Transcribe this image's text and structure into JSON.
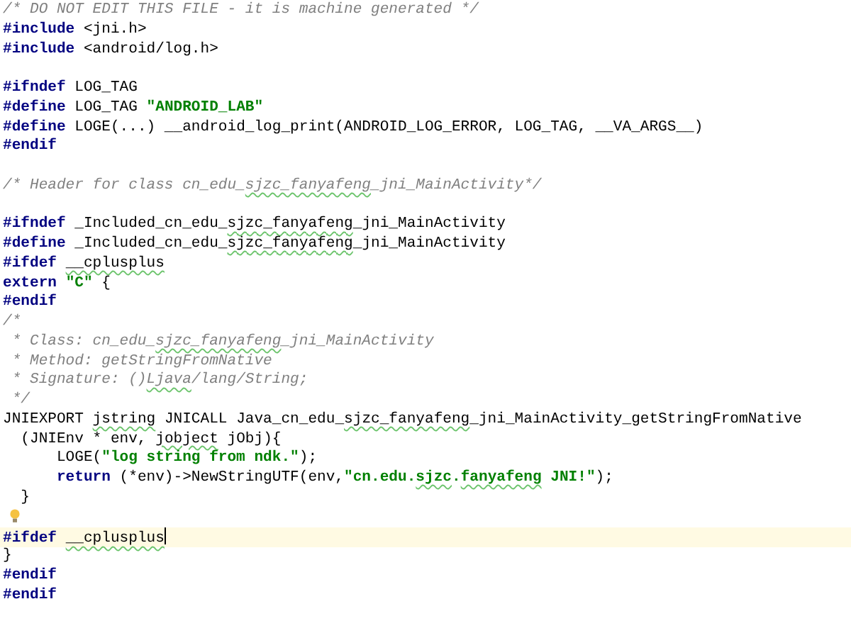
{
  "editor": {
    "lines": [
      {
        "current": false,
        "tokens": [
          {
            "text": "/* DO NOT EDIT THIS FILE - it is machine generated */",
            "kind": "comment"
          }
        ]
      },
      {
        "current": false,
        "tokens": [
          {
            "text": "#include",
            "kind": "keyword"
          },
          {
            "text": " <jni.h>",
            "kind": "plain"
          }
        ]
      },
      {
        "current": false,
        "tokens": [
          {
            "text": "#include",
            "kind": "keyword"
          },
          {
            "text": " <android/log.h>",
            "kind": "plain"
          }
        ]
      },
      {
        "current": false
      },
      {
        "current": false,
        "tokens": [
          {
            "text": "#ifndef",
            "kind": "keyword"
          },
          {
            "text": " LOG_TAG",
            "kind": "plain"
          }
        ]
      },
      {
        "current": false,
        "tokens": [
          {
            "text": "#define",
            "kind": "keyword"
          },
          {
            "text": " LOG_TAG ",
            "kind": "plain"
          },
          {
            "text": "\"ANDROID_LAB\"",
            "kind": "string"
          }
        ]
      },
      {
        "current": false,
        "tokens": [
          {
            "text": "#define",
            "kind": "keyword"
          },
          {
            "text": " LOGE(...) __android_log_print(ANDROID_LOG_ERROR, LOG_TAG, __VA_ARGS__)",
            "kind": "plain"
          }
        ]
      },
      {
        "current": false,
        "tokens": [
          {
            "text": "#endif",
            "kind": "keyword"
          }
        ]
      },
      {
        "current": false
      },
      {
        "current": false,
        "tokens": [
          {
            "text": "/* Header for class cn_edu_",
            "kind": "comment"
          },
          {
            "text": "sjzc_fanyafeng",
            "kind": "comment",
            "squiggle": true
          },
          {
            "text": "_jni_MainActivity*/",
            "kind": "comment"
          }
        ]
      },
      {
        "current": false
      },
      {
        "current": false,
        "tokens": [
          {
            "text": "#ifndef",
            "kind": "keyword"
          },
          {
            "text": " _Included_cn_edu_",
            "kind": "plain"
          },
          {
            "text": "sjzc_fanyafeng",
            "kind": "plain",
            "squiggle": true
          },
          {
            "text": "_jni_MainActivity",
            "kind": "plain"
          }
        ]
      },
      {
        "current": false,
        "tokens": [
          {
            "text": "#define",
            "kind": "keyword"
          },
          {
            "text": " _Included_cn_edu_",
            "kind": "plain"
          },
          {
            "text": "sjzc_fanyafeng",
            "kind": "plain",
            "squiggle": true
          },
          {
            "text": "_jni_MainActivity",
            "kind": "plain"
          }
        ]
      },
      {
        "current": false,
        "tokens": [
          {
            "text": "#ifdef ",
            "kind": "keyword"
          },
          {
            "text": "__cplusplus",
            "kind": "plain",
            "squiggle": true
          }
        ]
      },
      {
        "current": false,
        "tokens": [
          {
            "text": "extern ",
            "kind": "keyword"
          },
          {
            "text": "\"C\"",
            "kind": "string"
          },
          {
            "text": " {",
            "kind": "plain"
          }
        ]
      },
      {
        "current": false,
        "tokens": [
          {
            "text": "#endif",
            "kind": "keyword"
          }
        ]
      },
      {
        "current": false,
        "tokens": [
          {
            "text": "/*",
            "kind": "comment"
          }
        ]
      },
      {
        "current": false,
        "tokens": [
          {
            "text": " * Class: cn_edu_",
            "kind": "comment"
          },
          {
            "text": "sjzc_fanyafeng",
            "kind": "comment",
            "squiggle": true
          },
          {
            "text": "_jni_MainActivity",
            "kind": "comment"
          }
        ]
      },
      {
        "current": false,
        "tokens": [
          {
            "text": " * Method: getStringFromNative",
            "kind": "comment"
          }
        ]
      },
      {
        "current": false,
        "tokens": [
          {
            "text": " * Signature: ()",
            "kind": "comment"
          },
          {
            "text": "Ljava",
            "kind": "comment",
            "squiggle": true
          },
          {
            "text": "/lang/String;",
            "kind": "comment"
          }
        ]
      },
      {
        "current": false,
        "tokens": [
          {
            "text": " */",
            "kind": "comment"
          }
        ]
      },
      {
        "current": false,
        "tokens": [
          {
            "text": "JNIEXPORT ",
            "kind": "plain"
          },
          {
            "text": "jstring",
            "kind": "plain",
            "squiggle": true
          },
          {
            "text": " JNICALL Java_cn_edu_",
            "kind": "plain"
          },
          {
            "text": "sjzc_fanyafeng",
            "kind": "plain",
            "squiggle": true
          },
          {
            "text": "_jni_MainActivity_getStringFromNative",
            "kind": "plain"
          }
        ]
      },
      {
        "current": false,
        "tokens": [
          {
            "text": "  (JNIEnv * env, ",
            "kind": "plain"
          },
          {
            "text": "jobject",
            "kind": "plain",
            "squiggle": true
          },
          {
            "text": " jObj){",
            "kind": "plain"
          }
        ]
      },
      {
        "current": false,
        "tokens": [
          {
            "text": "      LOGE(",
            "kind": "plain"
          },
          {
            "text": "\"log string from ndk.\"",
            "kind": "string"
          },
          {
            "text": ");",
            "kind": "plain"
          }
        ]
      },
      {
        "current": false,
        "tokens": [
          {
            "text": "      return",
            "kind": "keyword"
          },
          {
            "text": " (*env)->NewStringUTF(env,",
            "kind": "plain"
          },
          {
            "text": "\"cn.edu.",
            "kind": "string"
          },
          {
            "text": "sjzc",
            "kind": "string",
            "squiggle": true
          },
          {
            "text": ".",
            "kind": "string"
          },
          {
            "text": "fanyafeng",
            "kind": "string",
            "squiggle": true
          },
          {
            "text": " JNI!\"",
            "kind": "string"
          },
          {
            "text": ");",
            "kind": "plain"
          }
        ]
      },
      {
        "current": false,
        "tokens": [
          {
            "text": "  }",
            "kind": "plain"
          }
        ]
      },
      {
        "current": false,
        "bulb": true
      },
      {
        "current": true,
        "tokens": [
          {
            "text": "#ifdef ",
            "kind": "keyword"
          },
          {
            "text": "__cplusplus",
            "kind": "plain",
            "squiggle": true
          }
        ]
      },
      {
        "current": false,
        "tokens": [
          {
            "text": "}",
            "kind": "plain"
          }
        ]
      },
      {
        "current": false,
        "tokens": [
          {
            "text": "#endif",
            "kind": "keyword"
          }
        ]
      },
      {
        "current": false,
        "tokens": [
          {
            "text": "#endif",
            "kind": "keyword"
          }
        ]
      }
    ]
  }
}
